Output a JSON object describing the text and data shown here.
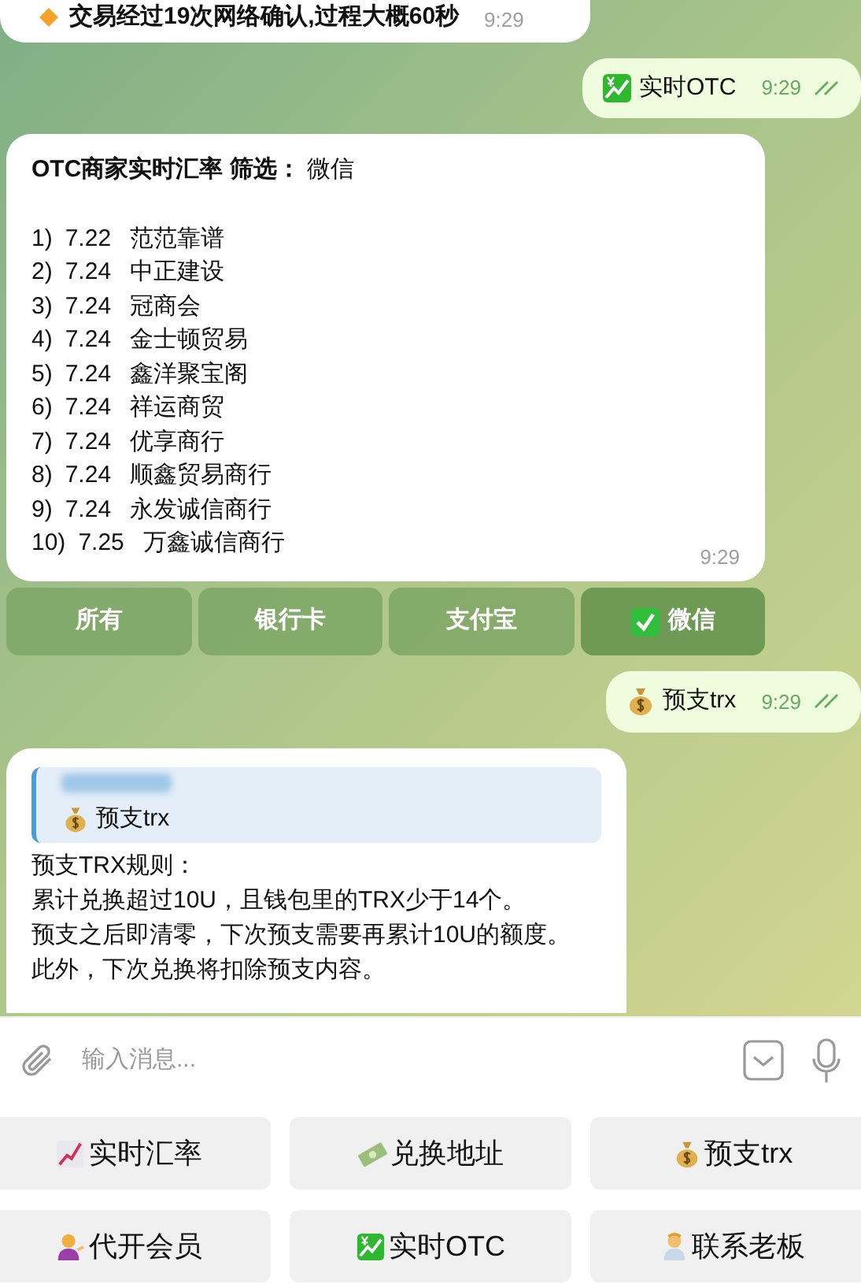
{
  "messages": [
    {
      "kind": "incoming_bullets",
      "lines": [
        "交易经过19次网络确认,过程大概60秒"
      ],
      "time": "9:29"
    },
    {
      "kind": "outgoing",
      "text": "实时OTC",
      "time": "9:29",
      "read": true
    },
    {
      "kind": "rates",
      "title": "OTC商家实时汇率 筛选：",
      "filter": "微信",
      "rows": [
        {
          "index": "1)",
          "rate": "7.22",
          "name": "范范靠谱"
        },
        {
          "index": "2)",
          "rate": "7.24",
          "name": "中正建设"
        },
        {
          "index": "3)",
          "rate": "7.24",
          "name": "冠商会"
        },
        {
          "index": "4)",
          "rate": "7.24",
          "name": "金士顿贸易"
        },
        {
          "index": "5)",
          "rate": "7.24",
          "name": "鑫洋聚宝阁"
        },
        {
          "index": "6)",
          "rate": "7.24",
          "name": "祥运商贸"
        },
        {
          "index": "7)",
          "rate": "7.24",
          "name": "优享商行"
        },
        {
          "index": "8)",
          "rate": "7.24",
          "name": "顺鑫贸易商行"
        },
        {
          "index": "9)",
          "rate": "7.24",
          "name": "永发诚信商行"
        },
        {
          "index": "10)",
          "rate": "7.25",
          "name": "万鑫诚信商行"
        }
      ],
      "time": "9:29",
      "buttons": [
        {
          "label": "所有",
          "selected": false
        },
        {
          "label": "银行卡",
          "selected": false
        },
        {
          "label": "支付宝",
          "selected": false
        },
        {
          "label": "微信",
          "selected": true
        }
      ]
    },
    {
      "kind": "outgoing",
      "text": "预支trx",
      "time": "9:29",
      "read": true
    },
    {
      "kind": "reply",
      "quote": "预支trx",
      "lines": [
        "预支TRX规则：",
        "累计兑换超过10U，且钱包里的TRX少于14个。",
        "预支之后即清零，下次预支需要再累计10U的额度。",
        "此外，下次兑换将扣除预支内容。"
      ]
    }
  ],
  "composer": {
    "placeholder": "输入消息..."
  },
  "keyboard": [
    {
      "label": "实时汇率"
    },
    {
      "label": "兑换地址"
    },
    {
      "label": "预支trx"
    },
    {
      "label": "代开会员"
    },
    {
      "label": "实时OTC"
    },
    {
      "label": "联系老板"
    }
  ]
}
